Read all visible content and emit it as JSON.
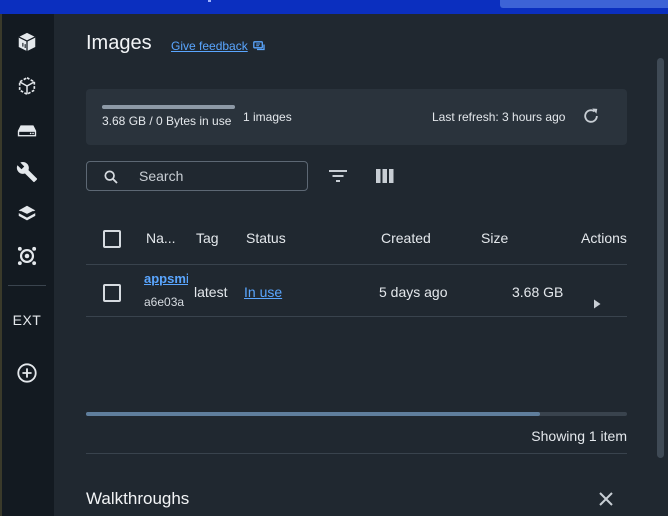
{
  "header": {
    "title": "Images",
    "feedback_label": "Give feedback"
  },
  "sidebar": {
    "items": [
      {
        "icon": "containers-icon"
      },
      {
        "icon": "images-icon"
      },
      {
        "icon": "volumes-icon"
      },
      {
        "icon": "dev-environments-icon"
      },
      {
        "icon": "learning-center-icon"
      },
      {
        "icon": "extensions-hub-icon"
      }
    ],
    "ext_label": "EXT",
    "add_extension_icon": "add-circle-icon"
  },
  "summary": {
    "usage_text": "3.68 GB / 0 Bytes in use",
    "usage_fraction": 1.0,
    "image_count": "1 images",
    "last_refresh": "Last refresh: 3 hours ago"
  },
  "search": {
    "placeholder": "Search",
    "value": ""
  },
  "table": {
    "columns": {
      "name": "Na...",
      "tag": "Tag",
      "status": "Status",
      "created": "Created",
      "size": "Size",
      "actions": "Actions"
    },
    "rows": [
      {
        "name": "appsmith",
        "id": "a6e03a",
        "tag": "latest",
        "status": "In use",
        "created": "5 days ago",
        "size": "3.68 GB"
      }
    ]
  },
  "footer": {
    "showing": "Showing 1 item",
    "scroll_fraction": 0.84
  },
  "walkthroughs": {
    "title": "Walkthroughs"
  },
  "colors": {
    "accent": "#0b2fbf",
    "link": "#5aa6ff",
    "background": "#202830",
    "sidebar": "#131a21",
    "panel": "#2a333c"
  }
}
